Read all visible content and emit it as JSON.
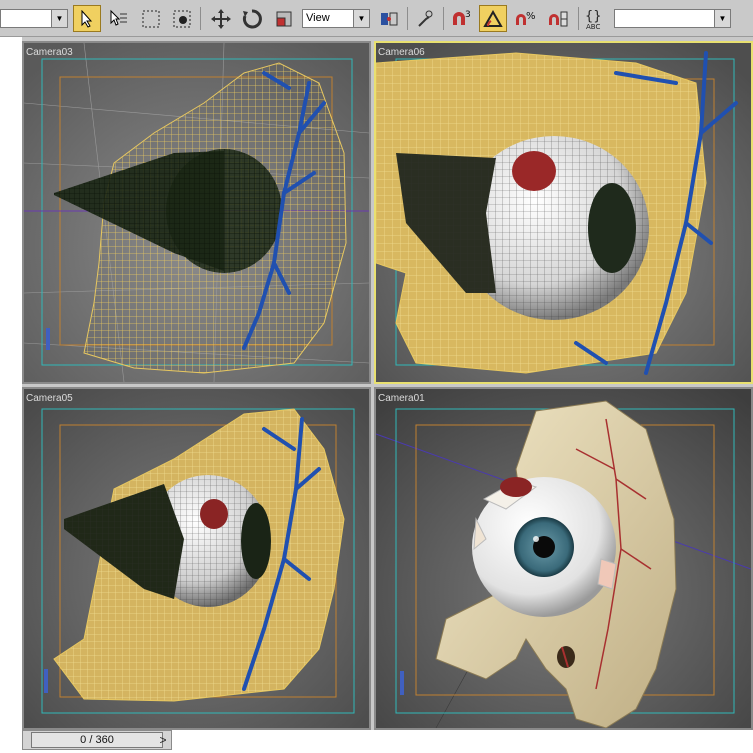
{
  "toolbar": {
    "view_dropdown": "View"
  },
  "viewports": [
    {
      "label": "Camera03"
    },
    {
      "label": "Camera06"
    },
    {
      "label": "Camera05"
    },
    {
      "label": "Camera01"
    }
  ],
  "timeslider": {
    "frame_readout": "0 / 360",
    "next_arrow": ">"
  },
  "colors": {
    "active_viewport_border": "#e8e070",
    "wireframe_face": "#e8c860",
    "vein": "#2050b0",
    "eye_wire": "#1a2a14"
  }
}
